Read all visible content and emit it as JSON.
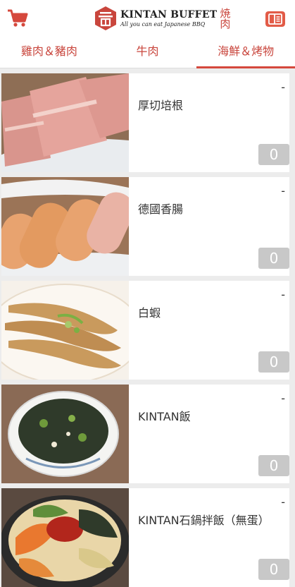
{
  "header": {
    "cart_icon": "shopping-cart-icon",
    "menu_icon": "menu-book-icon",
    "logo": {
      "title": "KINTAN BUFFET",
      "subtitle": "All you can eat Japanese BBQ",
      "kanji": "焼肉"
    }
  },
  "tabs": [
    {
      "label": "雞肉＆豬肉",
      "active": false
    },
    {
      "label": "牛肉",
      "active": false
    },
    {
      "label": "海鮮＆烤物",
      "active": true
    }
  ],
  "items": [
    {
      "name": "厚切培根",
      "dash": "-",
      "qty": "0"
    },
    {
      "name": "德國香腸",
      "dash": "-",
      "qty": "0"
    },
    {
      "name": "白蝦",
      "dash": "-",
      "qty": "0"
    },
    {
      "name": "KINTAN飯",
      "dash": "-",
      "qty": "0"
    },
    {
      "name": "KINTAN石鍋拌飯（無蛋）",
      "dash": "-",
      "qty": "0"
    }
  ],
  "colors": {
    "accent": "#d5483d",
    "qty_bg": "#c8c8c8"
  }
}
